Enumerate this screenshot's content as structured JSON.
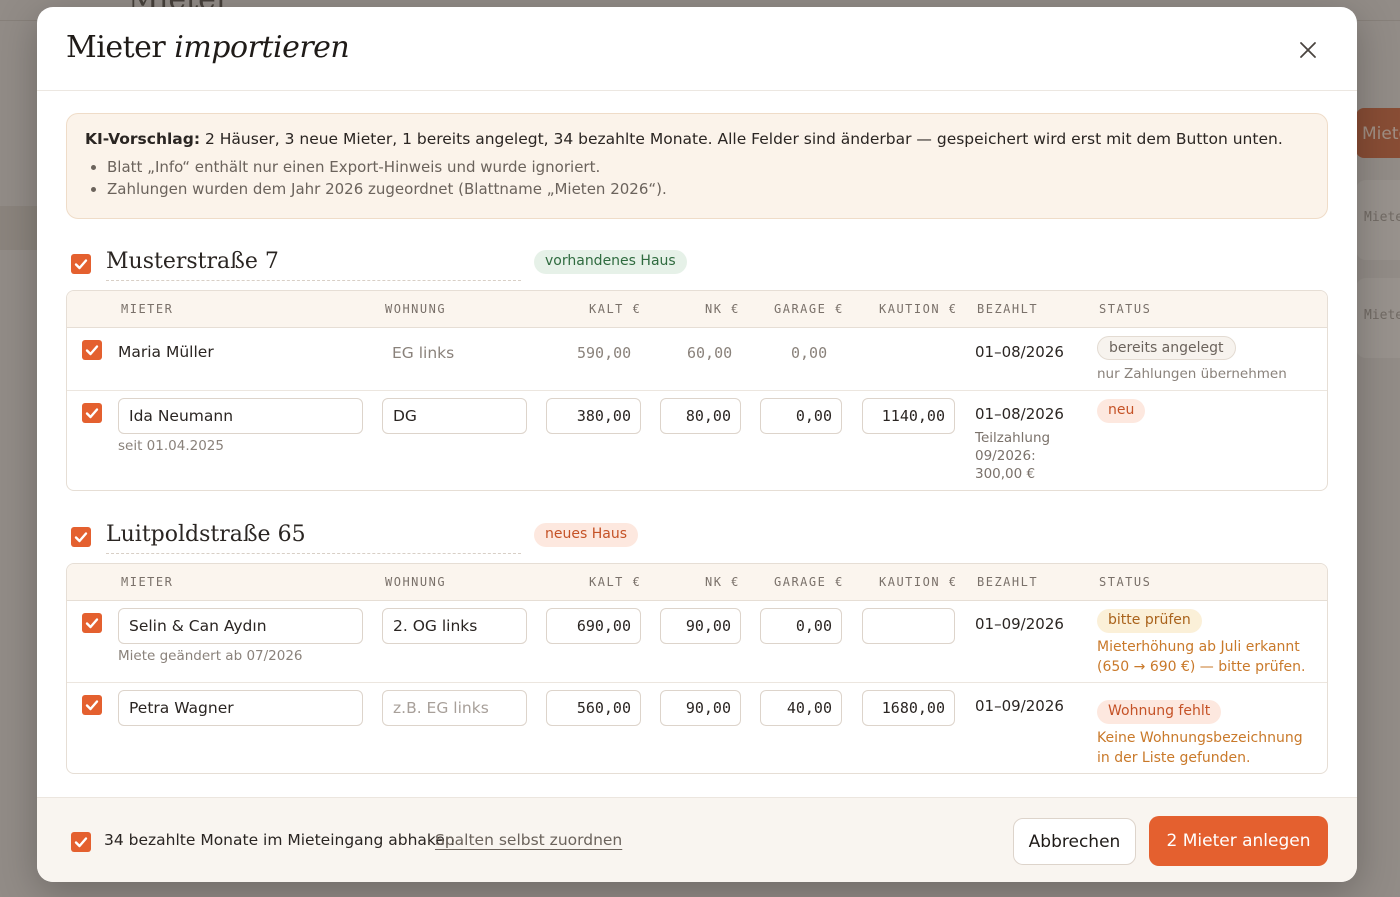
{
  "background": {
    "title": "Mieter",
    "button_label": "Miete",
    "card_labels": [
      "Miete",
      "Miete"
    ]
  },
  "modal": {
    "title_plain": "Mieter",
    "title_italic": "importieren",
    "close_icon": "close-icon"
  },
  "notice": {
    "label": "KI-Vorschlag:",
    "summary": "2 Häuser, 3 neue Mieter, 1 bereits angelegt, 34 bezahlte Monate. Alle Felder sind änderbar — gespeichert wird erst mit dem Button unten.",
    "bullets": [
      "Blatt „Info“ enthält nur einen Export-Hinweis und wurde ignoriert.",
      "Zahlungen wurden dem Jahr 2026 zugeordnet (Blattname „Mieten 2026“)."
    ]
  },
  "columns": [
    "MIETER",
    "WOHNUNG",
    "KALT €",
    "NK €",
    "GARAGE €",
    "KAUTION €",
    "BEZAHLT",
    "STATUS"
  ],
  "houses": [
    {
      "name": "Musterstraße 7",
      "badge": "vorhandenes Haus",
      "tenants": [
        {
          "name": "Maria Müller",
          "unit": "EG links",
          "kalt": "590,00",
          "nk": "60,00",
          "garage": "0,00",
          "kaution": "",
          "paid": "01–08/2026",
          "status": "bereits angelegt",
          "status_note": "nur Zahlungen übernehmen"
        },
        {
          "name": "Ida Neumann",
          "since": "seit 01.04.2025",
          "unit": "DG",
          "kalt": "380,00",
          "nk": "80,00",
          "garage": "0,00",
          "kaution": "1140,00",
          "paid": "01–08/2026",
          "paid_note": "Teilzahlung 09/2026: 300,00 €",
          "status": "neu"
        }
      ]
    },
    {
      "name": "Luitpoldstraße 65",
      "badge": "neues Haus",
      "tenants": [
        {
          "name": "Selin & Can Aydın",
          "since": "Miete geändert ab 07/2026",
          "unit": "2. OG links",
          "kalt": "690,00",
          "nk": "90,00",
          "garage": "0,00",
          "kaution": "",
          "paid": "01–09/2026",
          "status": "bitte prüfen",
          "status_note": "Mieterhöhung ab Juli erkannt (650 → 690 €) — bitte prüfen."
        },
        {
          "name": "Petra Wagner",
          "unit_placeholder": "z.B. EG links",
          "kalt": "560,00",
          "nk": "90,00",
          "garage": "40,00",
          "kaution": "1680,00",
          "paid": "01–09/2026",
          "status": "Wohnung fehlt",
          "status_note": "Keine Wohnungsbezeichnung in der Liste gefunden."
        }
      ]
    }
  ],
  "footer": {
    "checkbox_label": "34 bezahlte Monate im Mieteingang abhaken",
    "link": "Spalten selbst zuordnen",
    "cancel": "Abbrechen",
    "submit": "2 Mieter anlegen"
  },
  "colors": {
    "accent": "#e4602f",
    "warning_text": "#c9792a",
    "notice_bg": "#fbf3ea"
  }
}
